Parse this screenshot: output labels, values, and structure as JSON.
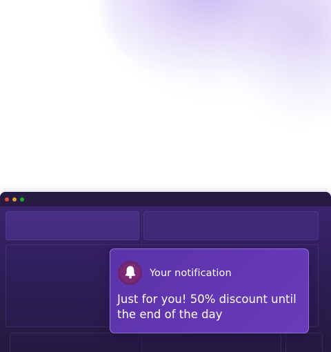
{
  "window": {
    "controls": [
      {
        "name": "close",
        "color": "#e0443e"
      },
      {
        "name": "minimize",
        "color": "#dea123"
      },
      {
        "name": "maximize",
        "color": "#1aab29"
      }
    ]
  },
  "notification": {
    "icon": "bell-icon",
    "title": "Your notification",
    "message": "Just for you! 50% discount until the end of the day"
  },
  "colors": {
    "accent": "#6236b2",
    "window_bg": "#2f1f5a",
    "icon_bg": "#7b2a78"
  }
}
